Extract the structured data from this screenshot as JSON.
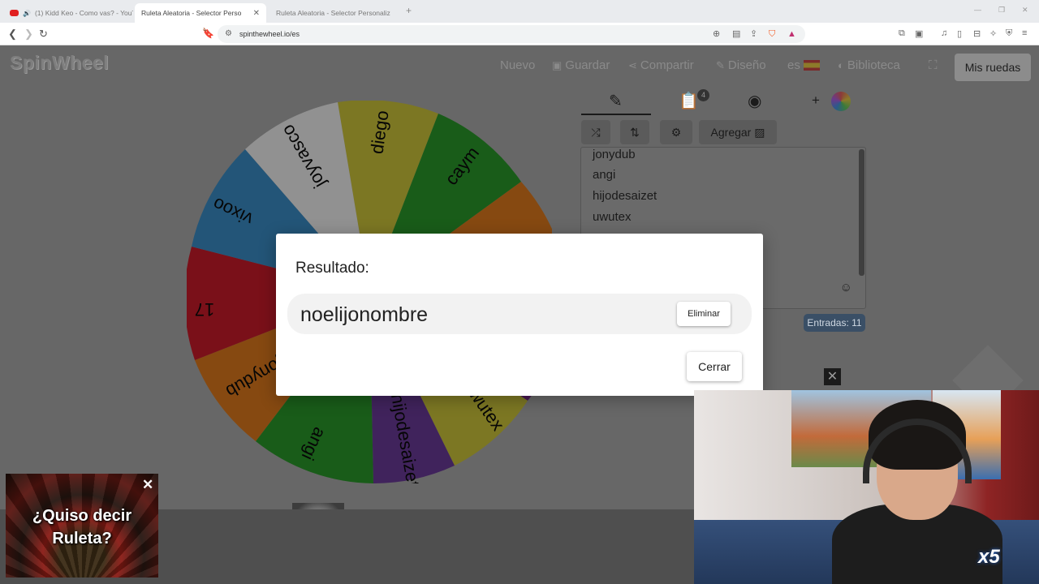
{
  "browser": {
    "tabs": [
      {
        "title": "(1) Kidd Keo - Como vas? - YouTu",
        "icon": "youtube-icon"
      },
      {
        "title": "Ruleta Aleatoria - Selector Perso",
        "icon": "wheel-favicon"
      },
      {
        "title": "Ruleta Aleatoria - Selector Personaliz",
        "icon": "wheel-favicon"
      }
    ],
    "url": "spinthewheel.io/es"
  },
  "app": {
    "logo": "SpinWheel",
    "menu": {
      "nuevo": "Nuevo",
      "guardar": "Guardar",
      "compartir": "Compartir",
      "diseno": "Diseño",
      "lang": "es",
      "biblioteca": "Biblioteca"
    },
    "mis_ruedas": "Mis ruedas",
    "add_image_label": "Agregar",
    "badge_count": "4",
    "entries": [
      "jonydub",
      "angi",
      "hijodesaizet",
      "uwutex"
    ],
    "entries_count": "Entradas: 11"
  },
  "wheel": {
    "segments": [
      {
        "label": "diego",
        "color": "#cfc63a"
      },
      {
        "label": "caym",
        "color": "#2a9a2a"
      },
      {
        "label": "",
        "color": "#e07a1c"
      },
      {
        "label": "",
        "color": "#5aa0d0"
      },
      {
        "label": "",
        "color": "#7a2a8a"
      },
      {
        "label": "uwutex",
        "color": "#cfc63a"
      },
      {
        "label": "hijodesaizet",
        "color": "#6a3a9a"
      },
      {
        "label": "angi",
        "color": "#2a9a2a"
      },
      {
        "label": "jonydub",
        "color": "#e07a1c"
      },
      {
        "label": "17",
        "color": "#cc1a2a"
      },
      {
        "label": "vixoo",
        "color": "#3a8ec8"
      },
      {
        "label": "joyvasco",
        "color": "#f2f2f2"
      }
    ]
  },
  "dialog": {
    "title": "Resultado:",
    "result": "noelijonombre",
    "remove_label": "Eliminar",
    "close_label": "Cerrar"
  },
  "ad": {
    "text": "¿Quiso decir Ruleta?"
  },
  "overlay": {
    "multiplier": "x5"
  }
}
